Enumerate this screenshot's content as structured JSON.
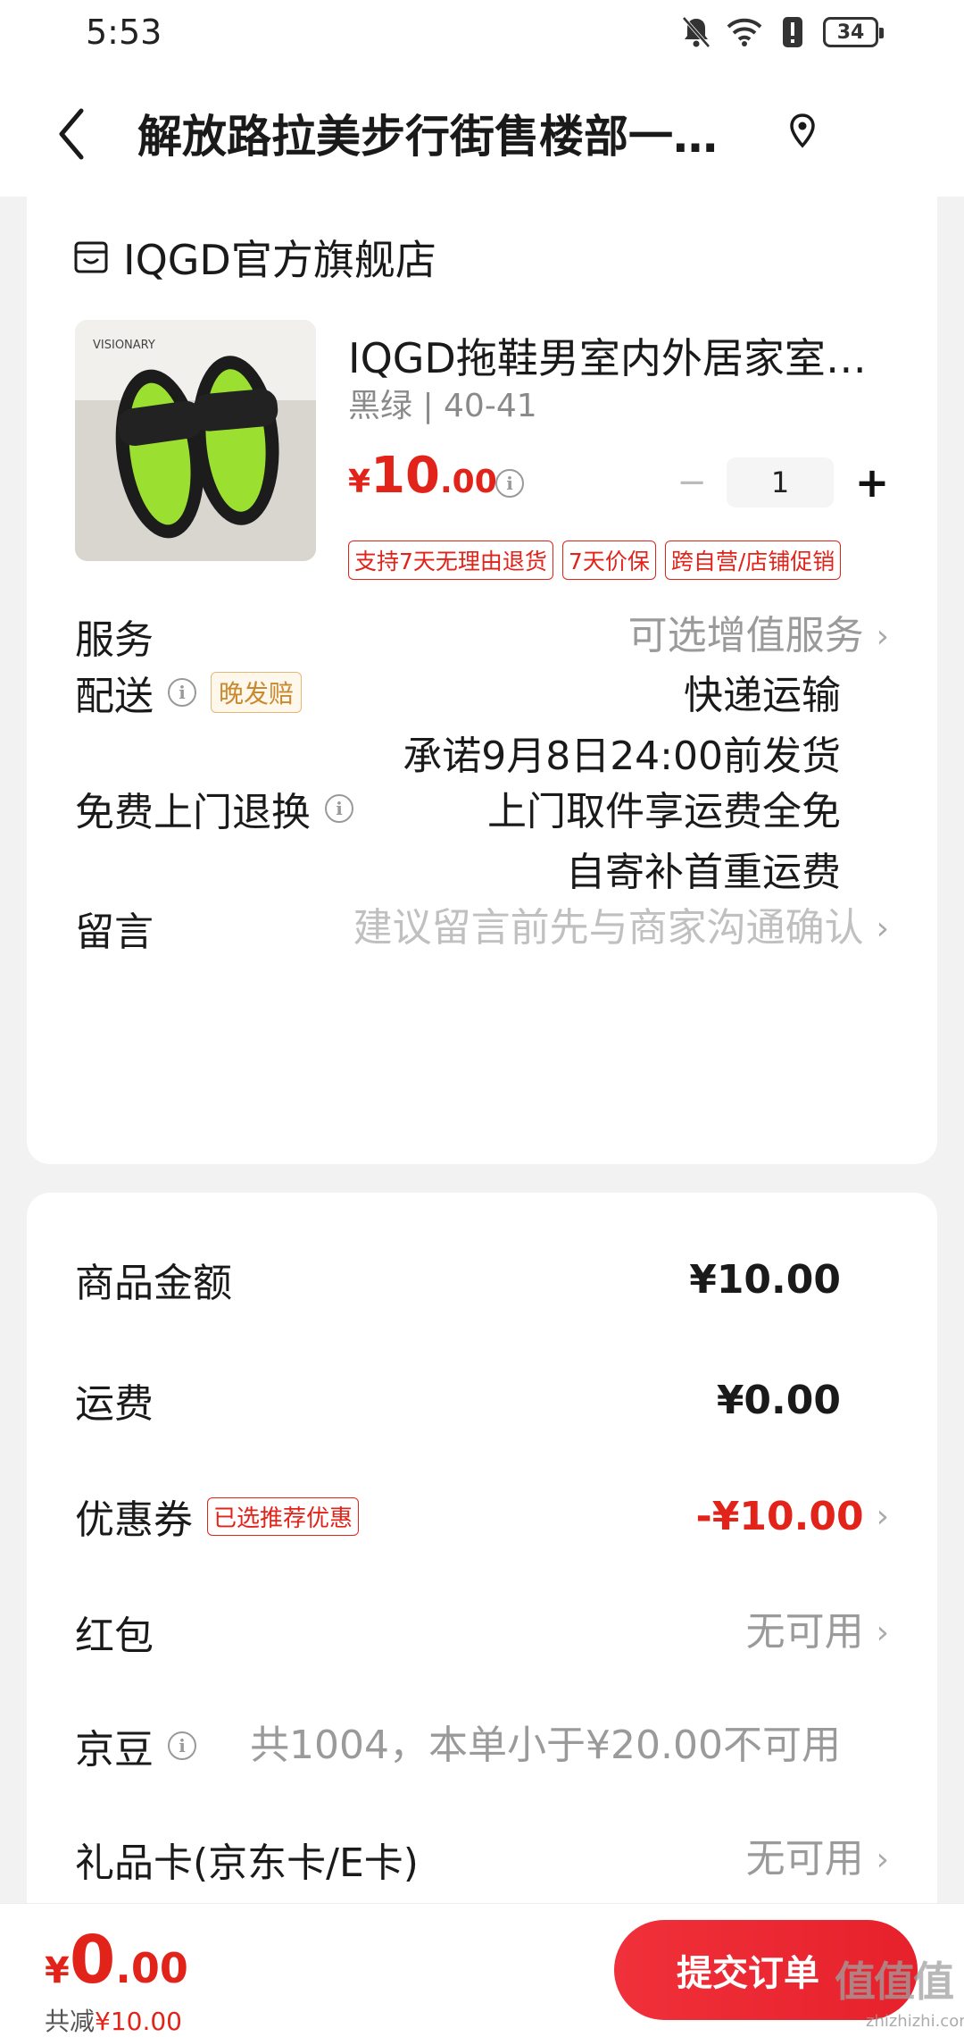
{
  "status_bar": {
    "time": "5:53",
    "battery": "34"
  },
  "header": {
    "title": "解放路拉美步行街售楼部一…"
  },
  "shop": {
    "name": "IQGD官方旗舰店"
  },
  "product": {
    "title": "IQGD拖鞋男室内外居家室…",
    "spec": "黑绿 | 40-41",
    "price_symbol": "¥",
    "price_int": "10",
    "price_dec": ".00",
    "quantity": "1",
    "minus": "−",
    "plus": "+",
    "image_text": "VISIONARY",
    "tags": [
      "支持7天无理由退货",
      "7天价保",
      "跨自营/店铺促销"
    ]
  },
  "service": {
    "label": "服务",
    "value": "可选增值服务"
  },
  "delivery": {
    "label": "配送",
    "badge": "晚发赔",
    "value_line1": "快递运输",
    "value_line2": "承诺9月8日24:00前发货"
  },
  "return": {
    "label": "免费上门退换",
    "value_line1": "上门取件享运费全免",
    "value_line2": "自寄补首重运费"
  },
  "message": {
    "label": "留言",
    "placeholder": "建议留言前先与商家沟通确认"
  },
  "summary": {
    "goods_label": "商品金额",
    "goods_value": "¥10.00",
    "shipping_label": "运费",
    "shipping_value": "¥0.00",
    "coupon_label": "优惠券",
    "coupon_badge": "已选推荐优惠",
    "coupon_value": "-¥10.00",
    "redpacket_label": "红包",
    "redpacket_value": "无可用",
    "jingdou_label": "京豆",
    "jingdou_value": "共1004，本单小于¥20.00不可用",
    "giftcard_label": "礼品卡(京东卡/E卡)",
    "giftcard_value": "无可用"
  },
  "footer": {
    "total_symbol": "¥",
    "total_int": "0",
    "total_dec": ".00",
    "saved_label": "共减",
    "saved_value": "¥10.00",
    "submit_label": "提交订单",
    "watermark": "值值值",
    "watermark_sub": "zhizhizhi.com"
  },
  "colors": {
    "accent": "#e2231a",
    "badge_gold": "#c98a2f"
  }
}
